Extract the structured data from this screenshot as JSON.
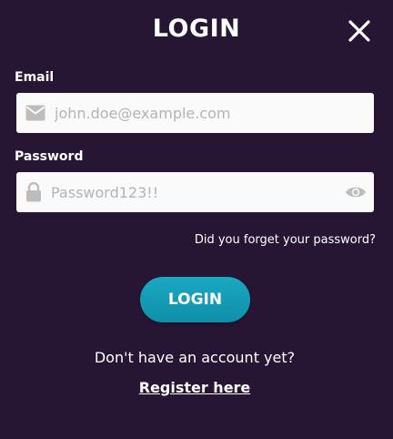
{
  "modal": {
    "title": "LOGIN",
    "close_icon": "close-icon"
  },
  "email": {
    "label": "Email",
    "placeholder": "john.doe@example.com",
    "value": "",
    "icon": "envelope-icon"
  },
  "password": {
    "label": "Password",
    "placeholder": "Password123!!",
    "value": "",
    "icon": "lock-icon",
    "toggle_icon": "eye-icon"
  },
  "forgot_link": "Did you forget your password?",
  "login_button": "LOGIN",
  "no_account_text": "Don't have an account yet?",
  "register_link": "Register here",
  "colors": {
    "background": "#261533",
    "button": "#1aa9c3",
    "input_bg": "#fafafa",
    "text": "#ffffff",
    "placeholder": "#b4b4b4",
    "icon": "#bdbdbd"
  }
}
